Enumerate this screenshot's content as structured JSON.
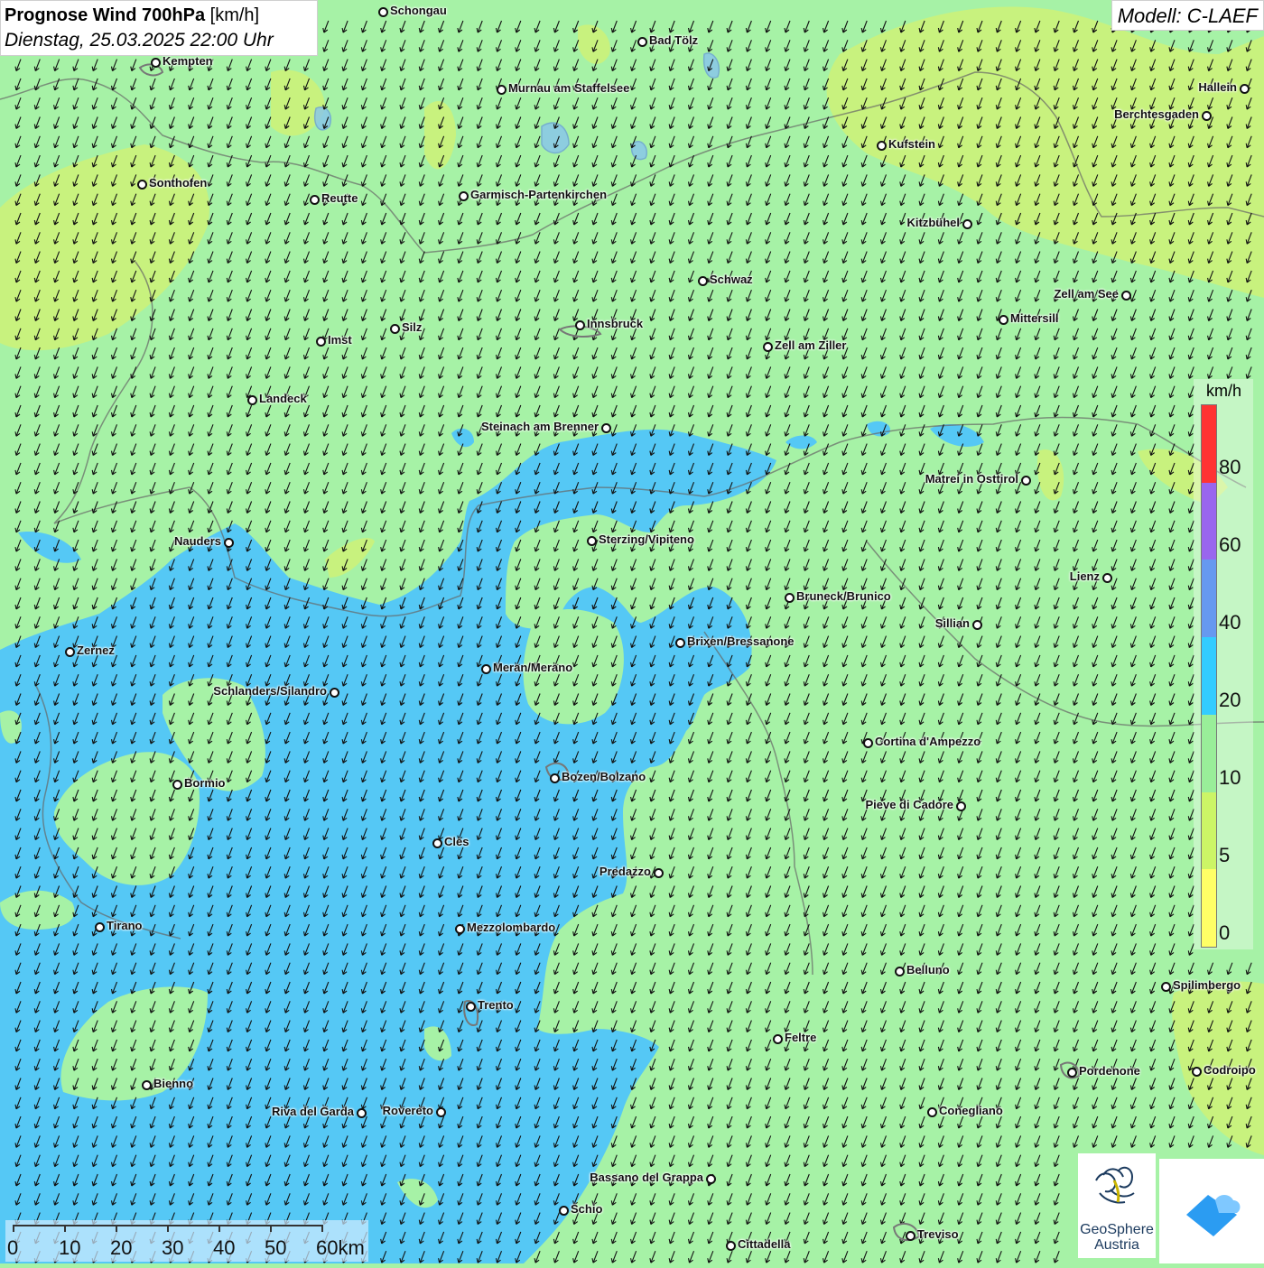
{
  "title": {
    "bold": "Prognose Wind 700hPa",
    "unit": "[km/h]",
    "date": "Dienstag, 25.03.2025 22:00 Uhr"
  },
  "model": "Modell: C-LAEF",
  "legend": {
    "unit": "km/h",
    "ticks": [
      "80",
      "60",
      "40",
      "20",
      "10",
      "5",
      "0"
    ],
    "colors": [
      "#ff3333",
      "#9966ee",
      "#6699f0",
      "#33ccff",
      "#99ee99",
      "#ccf566",
      "#ffff66"
    ]
  },
  "scalebar": {
    "labels": [
      "0",
      "10",
      "20",
      "30",
      "40",
      "50",
      "60km"
    ]
  },
  "map_colors": {
    "green": "#a6f2a6",
    "yellowgreen": "#ccf27a",
    "blue": "#55c8f5"
  },
  "wind_direction": "north-northeast to south-southwest",
  "cities": [
    {
      "name": "Schongau"
    },
    {
      "name": "Bad Tölz"
    },
    {
      "name": "Kempten"
    },
    {
      "name": "Murnau am Staffelsee"
    },
    {
      "name": "Hallein"
    },
    {
      "name": "Berchtesgaden"
    },
    {
      "name": "Kufstein"
    },
    {
      "name": "Sonthofen"
    },
    {
      "name": "Reutte"
    },
    {
      "name": "Garmisch-Partenkirchen"
    },
    {
      "name": "Kitzbühel"
    },
    {
      "name": "Schwaz"
    },
    {
      "name": "Zell am See"
    },
    {
      "name": "Mittersill"
    },
    {
      "name": "Innsbruck"
    },
    {
      "name": "Silz"
    },
    {
      "name": "Imst"
    },
    {
      "name": "Zell am Ziller"
    },
    {
      "name": "Landeck"
    },
    {
      "name": "Steinach am Brenner"
    },
    {
      "name": "Matrei in Osttirol"
    },
    {
      "name": "Nauders"
    },
    {
      "name": "Sterzing/Vipiteno"
    },
    {
      "name": "Lienz"
    },
    {
      "name": "Bruneck/Brunico"
    },
    {
      "name": "Sillian"
    },
    {
      "name": "Brixen/Bressanone"
    },
    {
      "name": "Zernez"
    },
    {
      "name": "Meran/Merano"
    },
    {
      "name": "Schlanders/Silandro"
    },
    {
      "name": "Cortina d'Ampezzo"
    },
    {
      "name": "Bozen/Bolzano"
    },
    {
      "name": "Bormio"
    },
    {
      "name": "Pieve di Cadore"
    },
    {
      "name": "Cles"
    },
    {
      "name": "Predazzo"
    },
    {
      "name": "Tirano"
    },
    {
      "name": "Mezzolombardo"
    },
    {
      "name": "Belluno"
    },
    {
      "name": "Spilimbergo"
    },
    {
      "name": "Trento"
    },
    {
      "name": "Feltre"
    },
    {
      "name": "Pordenone"
    },
    {
      "name": "Codroipo"
    },
    {
      "name": "Bienno"
    },
    {
      "name": "Riva del Garda"
    },
    {
      "name": "Rovereto"
    },
    {
      "name": "Conegliano"
    },
    {
      "name": "Bassano del Grappa"
    },
    {
      "name": "Schio"
    },
    {
      "name": "Treviso"
    },
    {
      "name": "Cittadella"
    }
  ],
  "logo": {
    "name_line1": "GeoSphere",
    "name_line2": "Austria"
  }
}
